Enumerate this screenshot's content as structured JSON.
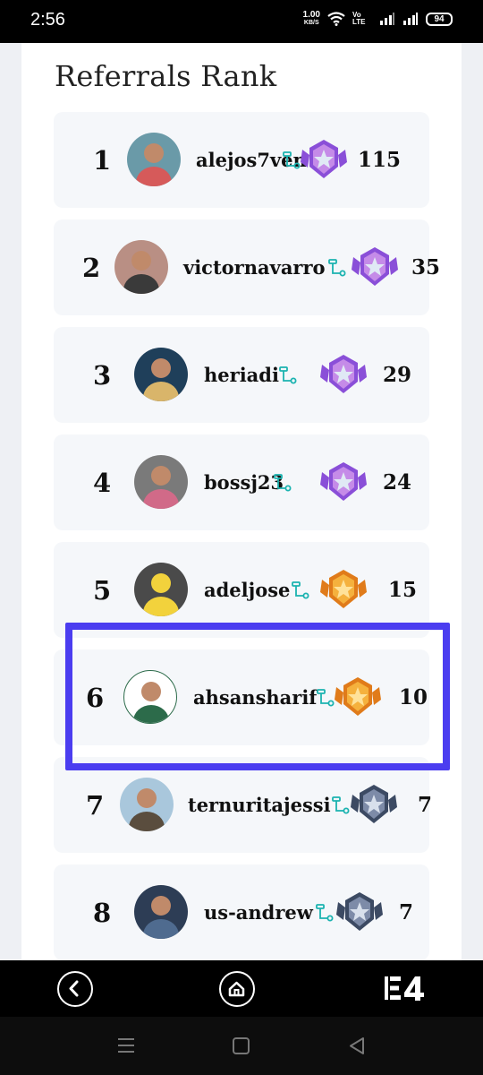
{
  "status": {
    "time": "2:56",
    "net_value": "1.00",
    "net_unit": "KB/S",
    "volte": "Vo LTE",
    "battery": "94"
  },
  "page": {
    "title": "Referrals Rank"
  },
  "accent_color": "#4b3df0",
  "ranks": [
    {
      "rank": "1",
      "username": "alejos7ven",
      "count": "115",
      "badge": "purple-star-badge"
    },
    {
      "rank": "2",
      "username": "victornavarro",
      "count": "35",
      "badge": "purple-star-badge"
    },
    {
      "rank": "3",
      "username": "heriadi",
      "count": "29",
      "badge": "purple-star-badge"
    },
    {
      "rank": "4",
      "username": "bossj23",
      "count": "24",
      "badge": "purple-star-badge"
    },
    {
      "rank": "5",
      "username": "adeljose",
      "count": "15",
      "badge": "gold-star-badge"
    },
    {
      "rank": "6",
      "username": "ahsansharif",
      "count": "10",
      "badge": "gold-star-badge"
    },
    {
      "rank": "7",
      "username": "ternuritajessi",
      "count": "7",
      "badge": "silver-star-badge"
    },
    {
      "rank": "8",
      "username": "us-andrew",
      "count": "7",
      "badge": "silver-star-badge"
    }
  ],
  "app_nav": {
    "back": "back-icon",
    "home": "home-icon",
    "logo": "E4"
  },
  "system_nav": [
    "recents-icon",
    "home-square-icon",
    "back-triangle-icon"
  ]
}
